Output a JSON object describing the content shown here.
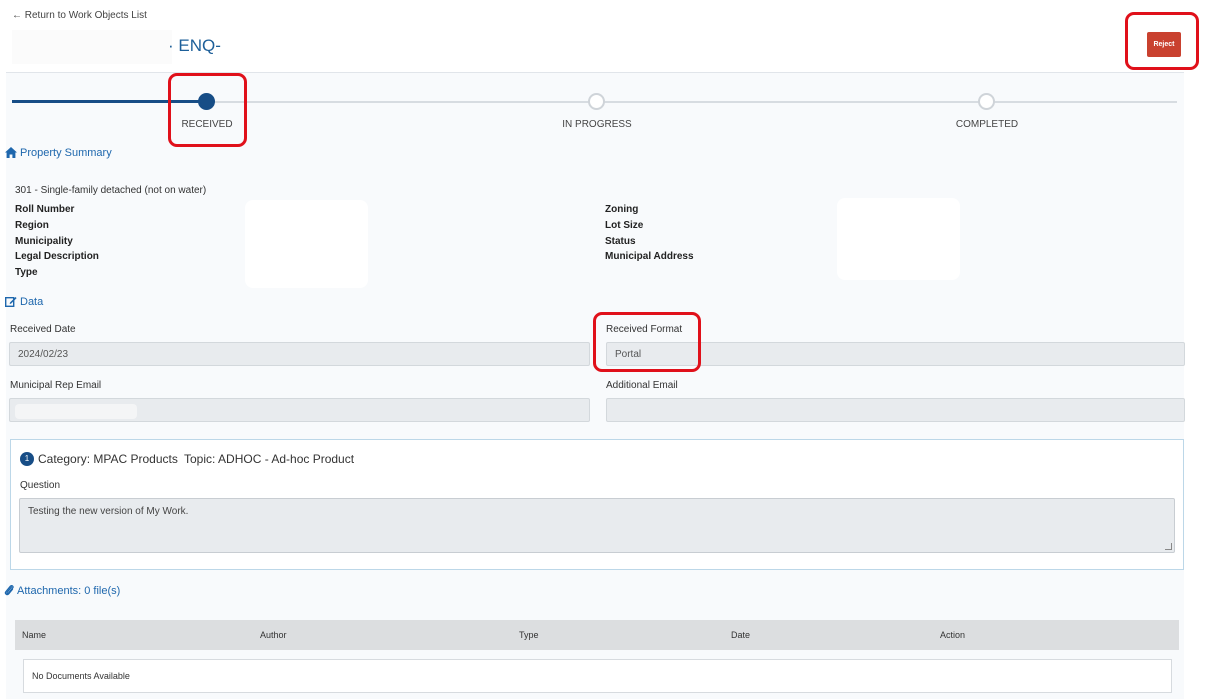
{
  "nav": {
    "back_link": "← Return to Work Objects List"
  },
  "header": {
    "title": "· ENQ-",
    "reject_label": "Reject"
  },
  "stepper": {
    "steps": [
      {
        "label": "RECEIVED",
        "state": "current"
      },
      {
        "label": "IN PROGRESS",
        "state": "pending"
      },
      {
        "label": "COMPLETED",
        "state": "pending"
      }
    ]
  },
  "property_summary": {
    "heading": "Property Summary",
    "icon": "home-icon",
    "type_value": "301 - Single-family detached (not on water)",
    "left_labels": [
      "Roll Number",
      "Region",
      "Municipality",
      "Legal Description",
      "Type"
    ],
    "right_labels": [
      "Zoning",
      "Lot Size",
      "Status",
      "Municipal Address"
    ]
  },
  "data_section": {
    "heading": "Data",
    "icon": "edit-icon",
    "received_date_label": "Received Date",
    "received_date_value": "2024/02/23",
    "received_format_label": "Received Format",
    "received_format_value": "Portal",
    "municipal_rep_email_label": "Municipal Rep Email",
    "municipal_rep_email_value": "",
    "additional_email_label": "Additional Email",
    "additional_email_value": ""
  },
  "category_card": {
    "number": "1",
    "category": "Category: MPAC Products",
    "topic": "Topic: ADHOC - Ad-hoc Product",
    "question_label": "Question",
    "question_value": "Testing the new version of My Work."
  },
  "attachments": {
    "heading": "Attachments: 0 file(s)",
    "icon": "paperclip-icon",
    "columns": [
      "Name",
      "Author",
      "Type",
      "Date",
      "Action"
    ],
    "empty_message": "No Documents Available"
  },
  "colors": {
    "primary": "#174d86",
    "link": "#1e67ad",
    "reject": "#c9412f",
    "highlight": "#e0101a"
  }
}
